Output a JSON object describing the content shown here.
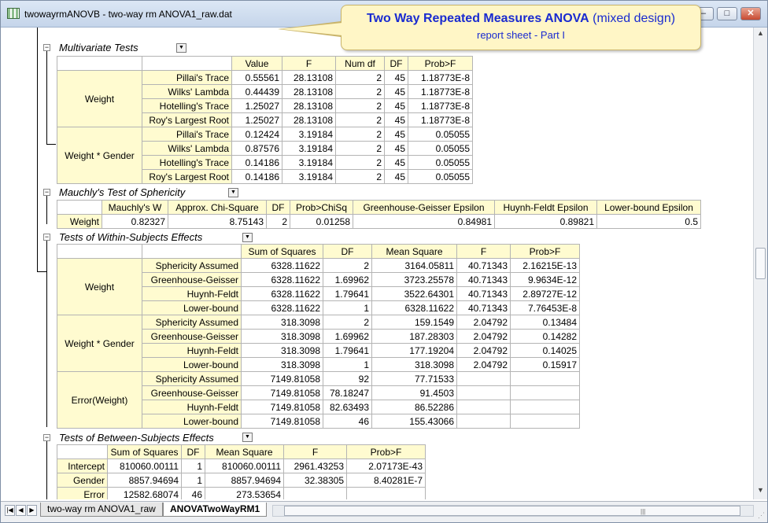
{
  "window": {
    "title": "twowayrmANOVB - two-way rm ANOVA1_raw.dat",
    "minimize": "–",
    "restore": "□",
    "close": "✕"
  },
  "callout": {
    "line1_bold": "Two Way Repeated Measures ANOVA",
    "line1_rest": " (mixed design)",
    "line2": "report sheet - Part I"
  },
  "multivariate": {
    "title": "Multivariate Tests",
    "headers": [
      "Value",
      "F",
      "Num df",
      "DF",
      "Prob>F"
    ],
    "groups": [
      {
        "name": "Weight",
        "rows": [
          {
            "label": "Pillai's Trace",
            "vals": [
              "0.55561",
              "28.13108",
              "2",
              "45",
              "1.18773E-8"
            ]
          },
          {
            "label": "Wilks' Lambda",
            "vals": [
              "0.44439",
              "28.13108",
              "2",
              "45",
              "1.18773E-8"
            ]
          },
          {
            "label": "Hotelling's Trace",
            "vals": [
              "1.25027",
              "28.13108",
              "2",
              "45",
              "1.18773E-8"
            ]
          },
          {
            "label": "Roy's Largest Root",
            "vals": [
              "1.25027",
              "28.13108",
              "2",
              "45",
              "1.18773E-8"
            ]
          }
        ]
      },
      {
        "name": "Weight * Gender",
        "rows": [
          {
            "label": "Pillai's Trace",
            "vals": [
              "0.12424",
              "3.19184",
              "2",
              "45",
              "0.05055"
            ]
          },
          {
            "label": "Wilks' Lambda",
            "vals": [
              "0.87576",
              "3.19184",
              "2",
              "45",
              "0.05055"
            ]
          },
          {
            "label": "Hotelling's Trace",
            "vals": [
              "0.14186",
              "3.19184",
              "2",
              "45",
              "0.05055"
            ]
          },
          {
            "label": "Roy's Largest Root",
            "vals": [
              "0.14186",
              "3.19184",
              "2",
              "45",
              "0.05055"
            ]
          }
        ]
      }
    ]
  },
  "mauchly": {
    "title": "Mauchly's Test of Sphericity",
    "headers": [
      "Mauchly's W",
      "Approx. Chi-Square",
      "DF",
      "Prob>ChiSq",
      "Greenhouse-Geisser Epsilon",
      "Huynh-Feldt Epsilon",
      "Lower-bound Epsilon"
    ],
    "row": {
      "label": "Weight",
      "vals": [
        "0.82327",
        "8.75143",
        "2",
        "0.01258",
        "0.84981",
        "0.89821",
        "0.5"
      ]
    }
  },
  "within": {
    "title": "Tests of Within-Subjects Effects",
    "headers": [
      "Sum of Squares",
      "DF",
      "Mean Square",
      "F",
      "Prob>F"
    ],
    "groups": [
      {
        "name": "Weight",
        "rows": [
          {
            "label": "Sphericity Assumed",
            "vals": [
              "6328.11622",
              "2",
              "3164.05811",
              "40.71343",
              "2.16215E-13"
            ]
          },
          {
            "label": "Greenhouse-Geisser",
            "vals": [
              "6328.11622",
              "1.69962",
              "3723.25578",
              "40.71343",
              "9.9634E-12"
            ]
          },
          {
            "label": "Huynh-Feldt",
            "vals": [
              "6328.11622",
              "1.79641",
              "3522.64301",
              "40.71343",
              "2.89727E-12"
            ]
          },
          {
            "label": "Lower-bound",
            "vals": [
              "6328.11622",
              "1",
              "6328.11622",
              "40.71343",
              "7.76453E-8"
            ]
          }
        ]
      },
      {
        "name": "Weight * Gender",
        "rows": [
          {
            "label": "Sphericity Assumed",
            "vals": [
              "318.3098",
              "2",
              "159.1549",
              "2.04792",
              "0.13484"
            ]
          },
          {
            "label": "Greenhouse-Geisser",
            "vals": [
              "318.3098",
              "1.69962",
              "187.28303",
              "2.04792",
              "0.14282"
            ]
          },
          {
            "label": "Huynh-Feldt",
            "vals": [
              "318.3098",
              "1.79641",
              "177.19204",
              "2.04792",
              "0.14025"
            ]
          },
          {
            "label": "Lower-bound",
            "vals": [
              "318.3098",
              "1",
              "318.3098",
              "2.04792",
              "0.15917"
            ]
          }
        ]
      },
      {
        "name": "Error(Weight)",
        "rows": [
          {
            "label": "Sphericity Assumed",
            "vals": [
              "7149.81058",
              "92",
              "77.71533",
              "",
              ""
            ]
          },
          {
            "label": "Greenhouse-Geisser",
            "vals": [
              "7149.81058",
              "78.18247",
              "91.4503",
              "",
              ""
            ]
          },
          {
            "label": "Huynh-Feldt",
            "vals": [
              "7149.81058",
              "82.63493",
              "86.52286",
              "",
              ""
            ]
          },
          {
            "label": "Lower-bound",
            "vals": [
              "7149.81058",
              "46",
              "155.43066",
              "",
              ""
            ]
          }
        ]
      }
    ]
  },
  "between": {
    "title": "Tests of Between-Subjects Effects",
    "headers": [
      "Sum of Squares",
      "DF",
      "Mean Square",
      "F",
      "Prob>F"
    ],
    "rows": [
      {
        "label": "Intercept",
        "vals": [
          "810060.00111",
          "1",
          "810060.00111",
          "2961.43253",
          "2.07173E-43"
        ]
      },
      {
        "label": "Gender",
        "vals": [
          "8857.94694",
          "1",
          "8857.94694",
          "32.38305",
          "8.40281E-7"
        ]
      },
      {
        "label": "Error",
        "vals": [
          "12582.68074",
          "46",
          "273.53654",
          "",
          ""
        ]
      }
    ]
  },
  "tabs": [
    {
      "label": "two-way rm ANOVA1_raw",
      "active": false
    },
    {
      "label": "ANOVATwoWayRM1",
      "active": true
    }
  ],
  "icons": {
    "dropdown": "dropdown-arrow-icon",
    "collapse": "collapse-minus-icon"
  }
}
